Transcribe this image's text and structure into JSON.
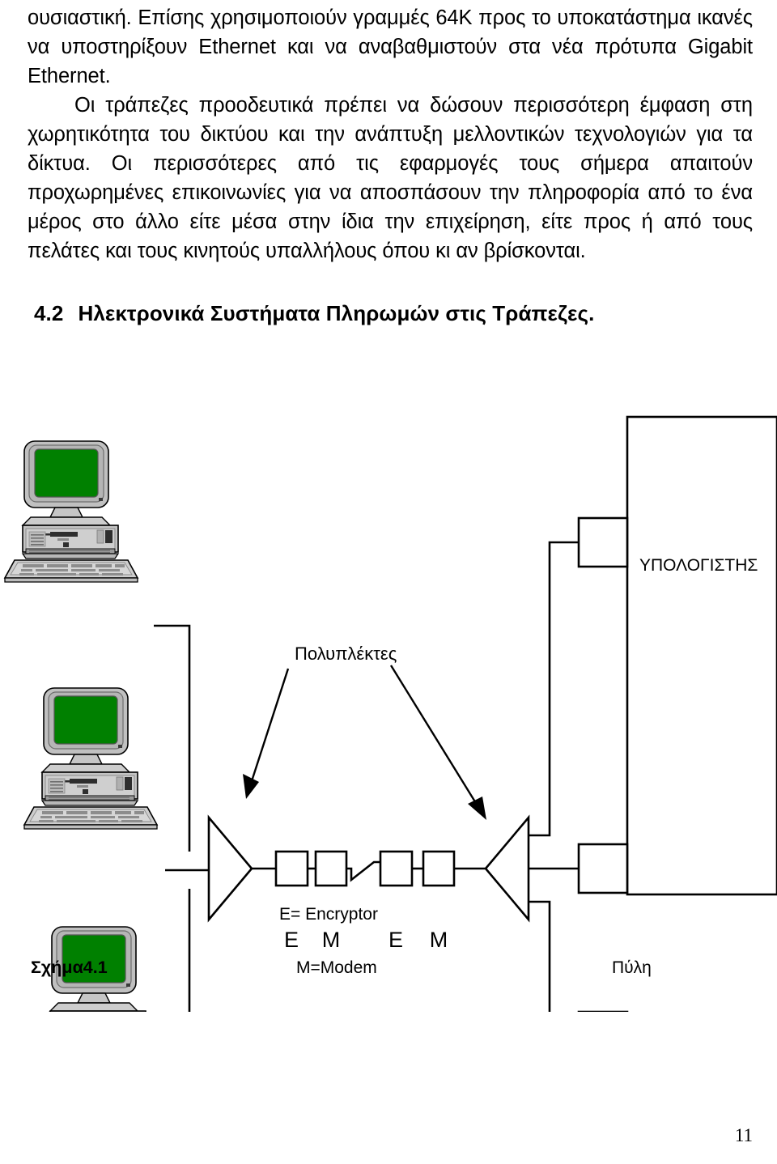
{
  "document": {
    "page_number": "11"
  },
  "body": {
    "paragraph_1": "ουσιαστική. Επίσης χρησιμοποιούν γραμμές 64K  προς το υποκατάστημα ικανές να υποστηρίξουν Ethernet και να αναβαθμιστούν στα νέα πρότυπα Gigabit Ethernet.",
    "paragraph_2": "Οι τράπεζες προοδευτικά πρέπει να δώσουν περισσότερη έμφαση στη χωρητικότητα του δικτύου και την ανάπτυξη μελλοντικών τεχνολογιών για τα δίκτυα.  Οι περισσότερες από τις εφαρμογές τους σήμερα απαιτούν προχωρημένες επικοινωνίες για να αποσπάσουν την πληροφορία από το ένα μέρος στο άλλο είτε μέσα στην ίδια την επιχείρηση, είτε προς ή από τους πελάτες και τους κινητούς υπαλλήλους όπου κι αν βρίσκονται."
  },
  "heading": {
    "number": "4.2",
    "title": "Ηλεκτρονικά Συστήματα Πληρωμών στις Τράπεζες."
  },
  "figure": {
    "caption": "Σχήμα4.1",
    "multiplexer_label": "Πολυπλέκτες",
    "host_label": "ΥΠΟΛΟΓΙΣΤΗΣ",
    "gateway_label": "Πύλη",
    "link_labels": [
      "E",
      "M",
      "E",
      "M"
    ],
    "legend": {
      "encryptor": "E= Encryptor",
      "modem": "M=Modem"
    },
    "colors": {
      "screen_green": "#008000",
      "case_gray": "#c0c0c0",
      "case_gray_dark": "#808080",
      "outline": "#000000"
    },
    "workstation_count": 3
  }
}
